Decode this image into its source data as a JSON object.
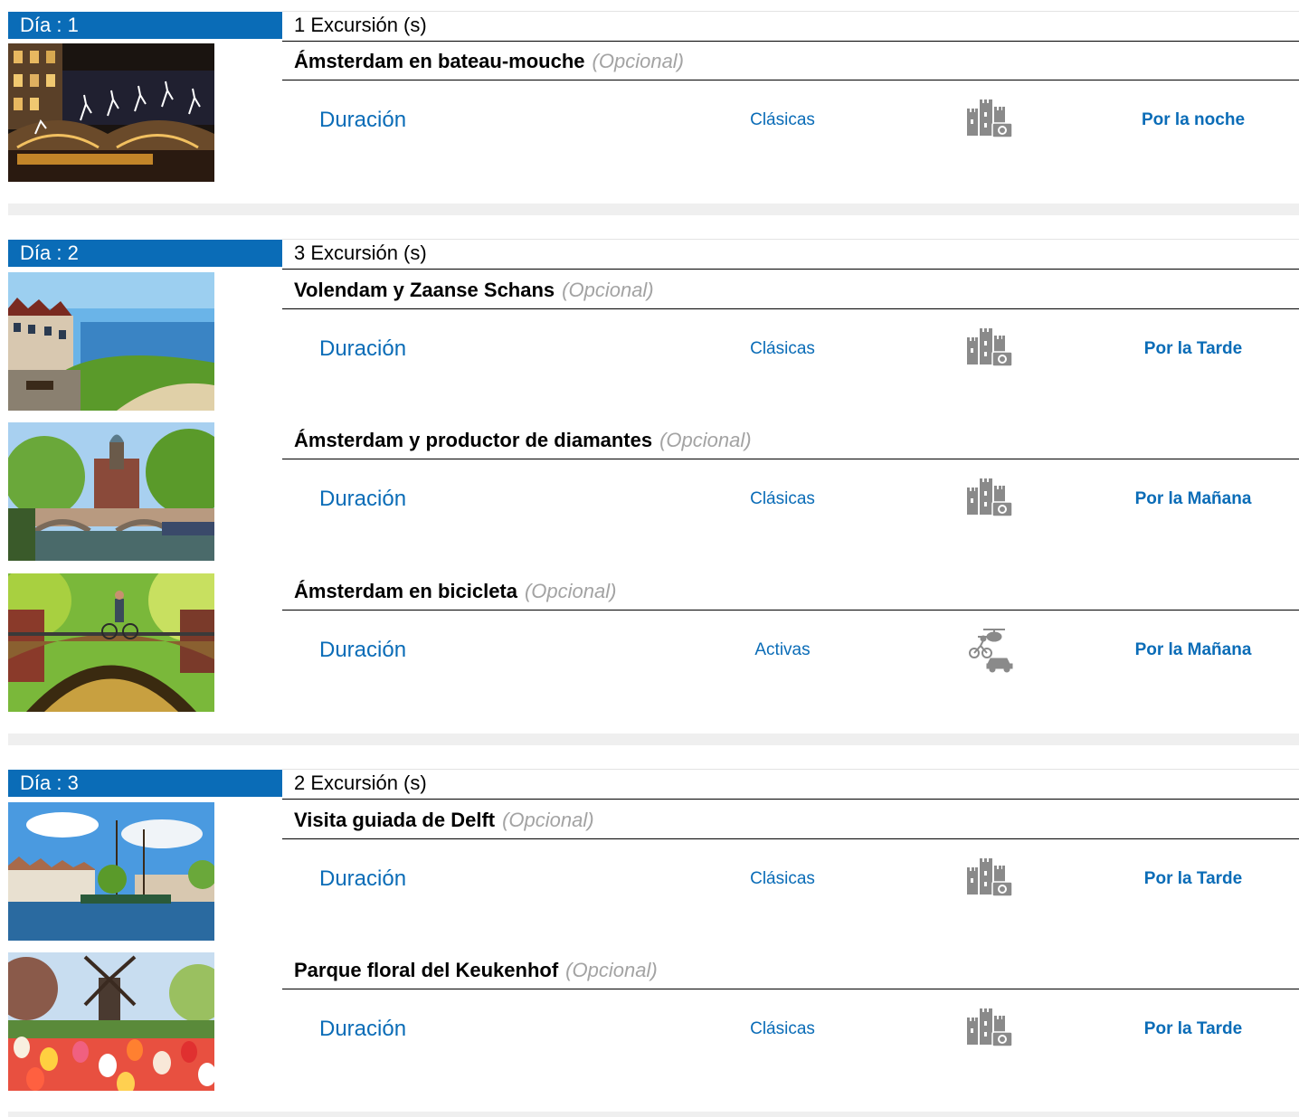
{
  "days": [
    {
      "label": "Día : 1",
      "count": "1 Excursión (s)",
      "excursions": [
        {
          "title": "Ámsterdam en bateau-mouche",
          "optional": "(Opcional)",
          "duration": "Duración",
          "category": "Clásicas",
          "icon": "castle-camera-icon",
          "time": "Por la noche",
          "image": "amsterdam-night-canal-image"
        }
      ]
    },
    {
      "label": "Día : 2",
      "count": "3 Excursión (s)",
      "excursions": [
        {
          "title": "Volendam y Zaanse Schans",
          "optional": "(Opcional)",
          "duration": "Duración",
          "category": "Clásicas",
          "icon": "castle-camera-icon",
          "time": "Por la Tarde",
          "image": "volendam-harbor-image"
        },
        {
          "title": "Ámsterdam y productor de diamantes",
          "optional": "(Opcional)",
          "duration": "Duración",
          "category": "Clásicas",
          "icon": "castle-camera-icon",
          "time": "Por la Mañana",
          "image": "amsterdam-canal-church-image"
        },
        {
          "title": "Ámsterdam en bicicleta",
          "optional": "(Opcional)",
          "duration": "Duración",
          "category": "Activas",
          "icon": "activities-helicopter-bike-car-icon",
          "time": "Por la Mañana",
          "image": "amsterdam-bridge-cyclist-image"
        }
      ]
    },
    {
      "label": "Día : 3",
      "count": "2 Excursión (s)",
      "excursions": [
        {
          "title": "Visita guiada de Delft",
          "optional": "(Opcional)",
          "duration": "Duración",
          "category": "Clásicas",
          "icon": "castle-camera-icon",
          "time": "Por la Tarde",
          "image": "delft-harbor-boats-image"
        },
        {
          "title": "Parque floral del Keukenhof",
          "optional": "(Opcional)",
          "duration": "Duración",
          "category": "Clásicas",
          "icon": "castle-camera-icon",
          "time": "Por la Tarde",
          "image": "keukenhof-tulips-windmill-image"
        }
      ]
    }
  ],
  "colors": {
    "accent": "#0a6cb7",
    "optional": "#a3a3a3",
    "separator": "#efefef",
    "icon": "#8a8a8a"
  }
}
